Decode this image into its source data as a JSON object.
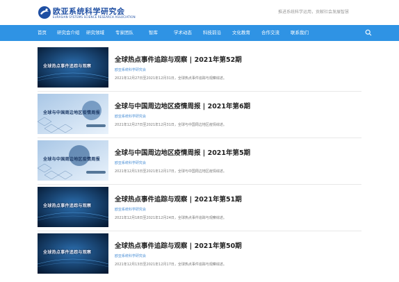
{
  "header": {
    "logo_cn": "欧亚系统科学研究会",
    "logo_en": "EURASIAN SYSTEMS SCIENCE RESEARCH ASSOCIATION",
    "slogan": "推进系统科学运用，贡献社会发展智慧"
  },
  "nav": {
    "items": [
      "首页",
      "研究会介绍",
      "研究领域",
      "专家团队",
      "智库",
      "学术动态",
      "科技前沿",
      "文化教育",
      "合作交流",
      "联系我们"
    ]
  },
  "articles": [
    {
      "thumb_caption": "全球热点事件追踪与观察",
      "title": "全球热点事件追踪与观察 | 2021年第52期",
      "source": "欧亚系统科学研究会",
      "desc": "2021年12月27日至2021年12月31日，全球热点事件追踪与观察综述。"
    },
    {
      "thumb_caption": "全球与中国周边地区疫情周报",
      "title": "全球与中国周边地区疫情周报 | 2021年第6期",
      "source": "欧亚系统科学研究会",
      "desc": "2021年12月27日至2021年12月31日，全球与中国周边地区疫情综述。"
    },
    {
      "thumb_caption": "全球与中国周边地区疫情周报",
      "title": "全球与中国周边地区疫情周报 | 2021年第5期",
      "source": "欧亚系统科学研究会",
      "desc": "2021年12月13日至2021年12月17日，全球与中国周边地区疫情综述。"
    },
    {
      "thumb_caption": "全球热点事件追踪与观察",
      "title": "全球热点事件追踪与观察 | 2021年第51期",
      "source": "欧亚系统科学研究会",
      "desc": "2021年12月18日至2021年12月24日，全球热点事件追踪与观察综述。"
    },
    {
      "thumb_caption": "全球热点事件追踪与观察",
      "title": "全球热点事件追踪与观察 | 2021年第50期",
      "source": "欧亚系统科学研究会",
      "desc": "2021年12月13日至2021年12月17日，全球热点事件追踪与观察综述。"
    }
  ]
}
